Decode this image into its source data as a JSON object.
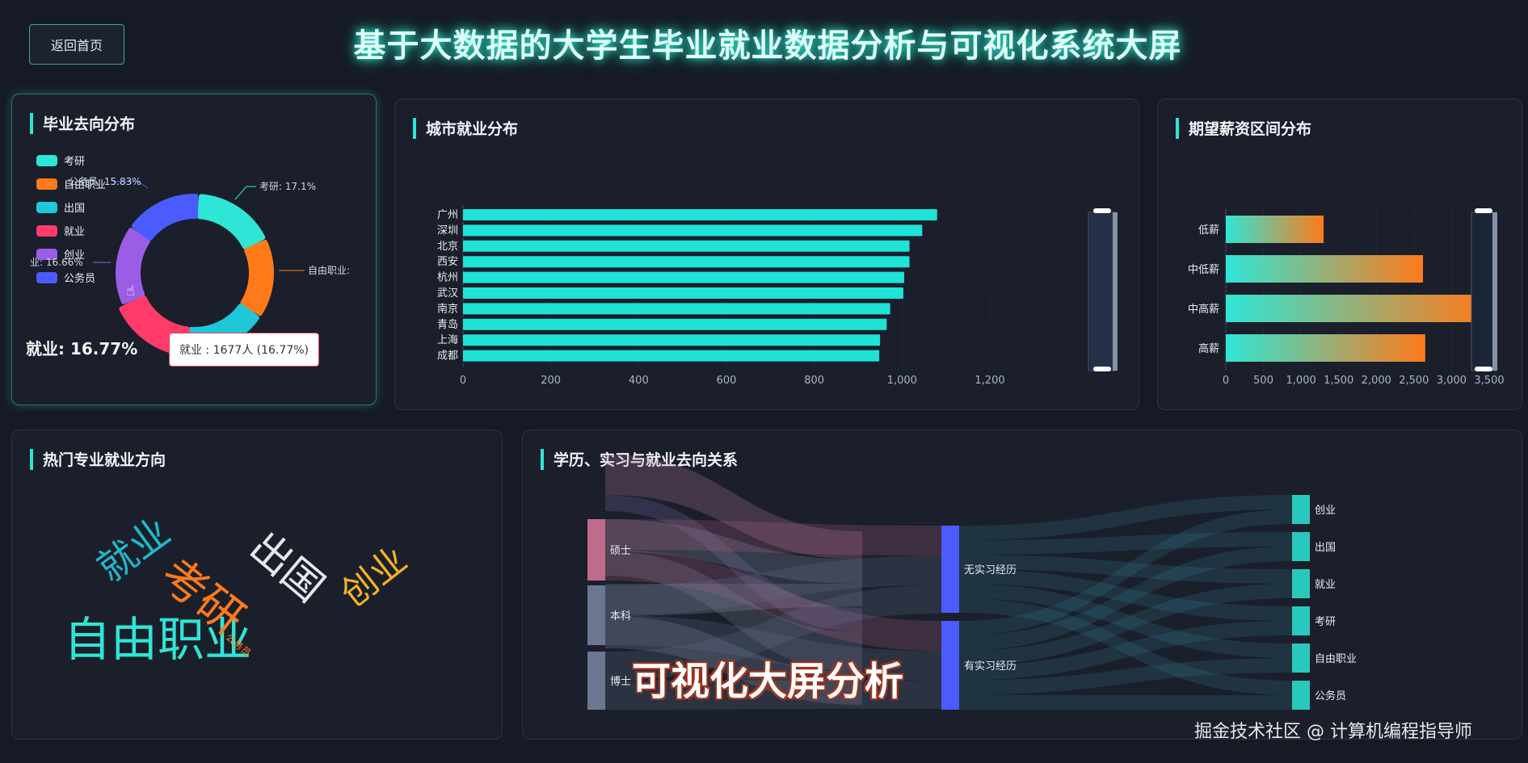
{
  "header": {
    "back_button": "返回首页",
    "title": "基于大数据的大学生毕业就业数据分析与可视化系统大屏"
  },
  "panels": {
    "destination": {
      "title": "毕业去向分布",
      "legend": [
        "考研",
        "自由职业",
        "出国",
        "就业",
        "创业",
        "公务员"
      ],
      "callouts": {
        "kaoyan": "考研: 17.1%",
        "freelance": "自由职业:",
        "chuangye": "业: 16.66%",
        "gongwuyuan": "公务员: 15.83%"
      },
      "emphasis": "就业: 16.77%",
      "tooltip": "就业 : 1677人 (16.77%)",
      "colors": [
        "#2ee6d6",
        "#ff7a1a",
        "#1fc8d8",
        "#ff3b6a",
        "#9b5de5",
        "#4a5cff"
      ]
    },
    "city": {
      "title": "城市就业分布",
      "bar_color": "#1ee3d6"
    },
    "salary": {
      "title": "期望薪资区间分布"
    },
    "majors": {
      "title": "热门专业就业方向",
      "words": [
        {
          "text": "自由职业",
          "color": "#2ee6d6"
        },
        {
          "text": "就业",
          "color": "#20b8c8"
        },
        {
          "text": "考研",
          "color": "#ff7a1a"
        },
        {
          "text": "出国",
          "color": "#e8e8e8"
        },
        {
          "text": "创业",
          "color": "#f5b323"
        },
        {
          "text": "公务员",
          "color": "#ff7a1a"
        }
      ]
    },
    "sankey": {
      "title": "学历、实习与就业去向关系",
      "left_nodes": [
        "硕士",
        "本科",
        "博士"
      ],
      "mid_nodes": [
        "无实习经历",
        "有实习经历"
      ],
      "right_nodes": [
        "创业",
        "出国",
        "就业",
        "考研",
        "自由职业",
        "公务员"
      ]
    }
  },
  "overlay_text": "可视化大屏分析",
  "watermark": "掘金技术社区 @ 计算机编程指导师",
  "chart_data": [
    {
      "type": "pie",
      "title": "毕业去向分布",
      "categories": [
        "考研",
        "自由职业",
        "出国",
        "就业",
        "创业",
        "公务员"
      ],
      "values": [
        17.1,
        16.5,
        17.1,
        16.77,
        16.66,
        15.83
      ],
      "unit": "%"
    },
    {
      "type": "bar",
      "title": "城市就业分布",
      "orientation": "horizontal",
      "categories": [
        "广州",
        "深圳",
        "北京",
        "西安",
        "杭州",
        "武汉",
        "南京",
        "青岛",
        "上海",
        "成都"
      ],
      "values": [
        1080,
        1046,
        1017,
        1017,
        1005,
        1003,
        973,
        965,
        950,
        948
      ],
      "xlim": [
        0,
        1200
      ],
      "ticks": [
        "0",
        "200",
        "400",
        "600",
        "800",
        "1,000",
        "1,200"
      ]
    },
    {
      "type": "bar",
      "title": "期望薪资区间分布",
      "orientation": "horizontal",
      "categories": [
        "低薪",
        "中低薪",
        "中高薪",
        "高薪"
      ],
      "values": [
        1300,
        2620,
        3420,
        2650
      ],
      "xlim": [
        0,
        3500
      ],
      "ticks": [
        "0",
        "500",
        "1,000",
        "1,500",
        "2,000",
        "2,500",
        "3,000",
        "3,500"
      ]
    }
  ]
}
